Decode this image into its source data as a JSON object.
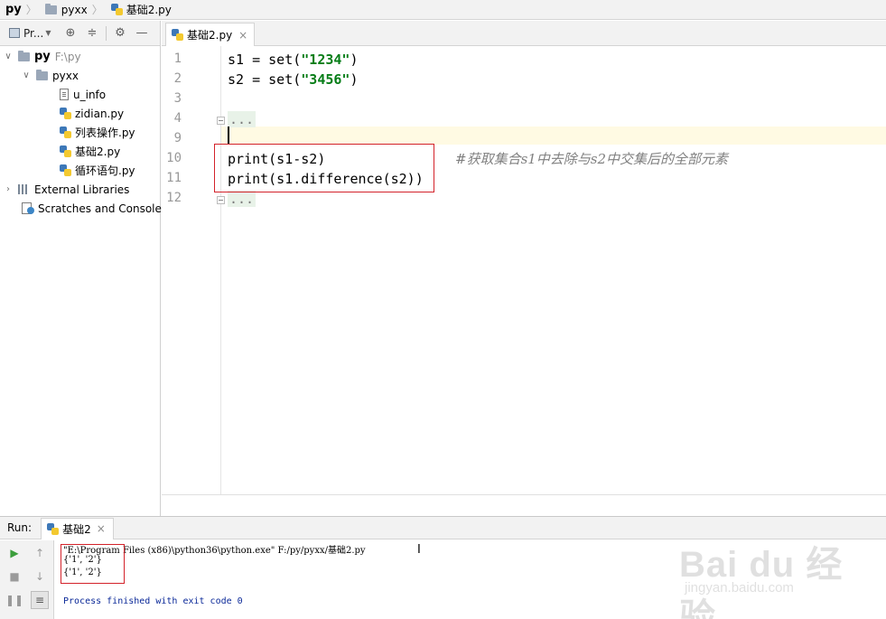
{
  "breadcrumb": {
    "root": "py",
    "folder": "pyxx",
    "file": "基础2.py"
  },
  "project_panel": {
    "selector_label": "Pr...",
    "root_name": "py",
    "root_path": "F:\\py",
    "folder": "pyxx",
    "files": [
      "u_info",
      "zidian.py",
      "列表操作.py",
      "基础2.py",
      "循环语句.py"
    ],
    "external_libraries": "External Libraries",
    "scratches": "Scratches and Consoles"
  },
  "editor": {
    "tab_title": "基础2.py",
    "tab_close": "×",
    "line_numbers": [
      "1",
      "2",
      "3",
      "4",
      "9",
      "10",
      "11",
      "12"
    ],
    "lines": {
      "l1_a": "s1 = set(",
      "l1_str": "\"1234\"",
      "l1_b": ")",
      "l2_a": "s2 = set(",
      "l2_str": "\"3456\"",
      "l2_b": ")",
      "l4_fold": "...",
      "l10": "print(s1-s2)",
      "l11": "print(s1.difference(s2))",
      "l12_fold": "..."
    },
    "comment": "#获取集合s1中去除与s2中交集后的全部元素"
  },
  "run_panel": {
    "label": "Run:",
    "tab_title": "基础2",
    "tab_close": "×",
    "output": [
      "\"E:\\Program Files (x86)\\python36\\python.exe\" F:/py/pyxx/基础2.py",
      "{'1', '2'}",
      "{'1', '2'}",
      "Process finished with exit code 0"
    ]
  },
  "watermark": {
    "brand": "Bai du 经验",
    "url": "jingyan.baidu.com"
  },
  "colors": {
    "string": "#067d17",
    "current_line": "#fffae3",
    "highlight_box": "#d3222a",
    "process_text": "#0a2898"
  }
}
